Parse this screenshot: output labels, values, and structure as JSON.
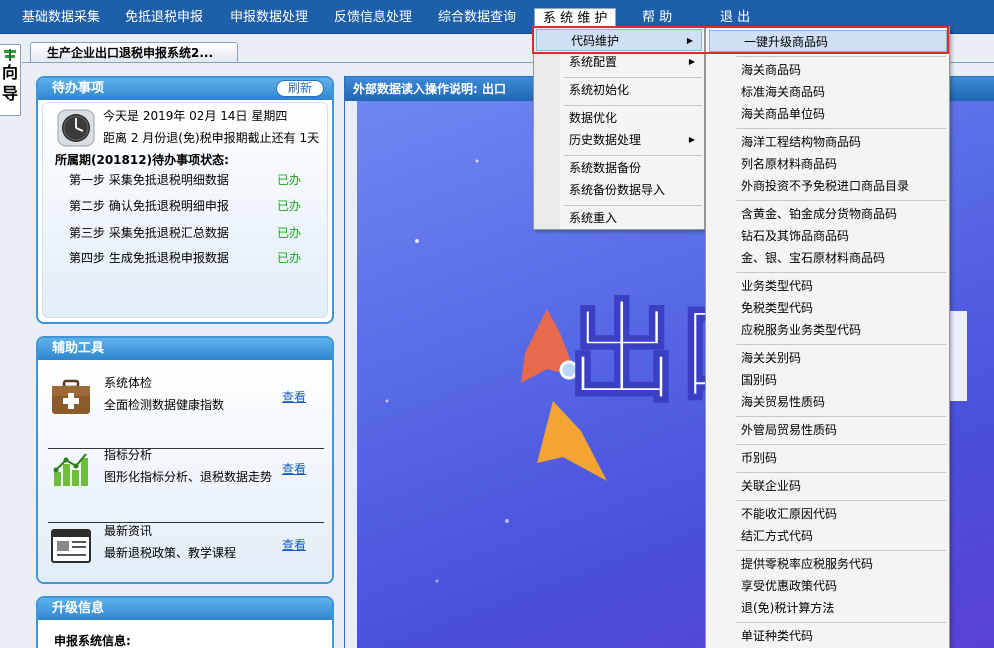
{
  "menubar": {
    "items": [
      "基础数据采集",
      "免抵退税申报",
      "申报数据处理",
      "反馈信息处理",
      "综合数据查询",
      "系 统 维 护",
      "帮   助",
      "退   出"
    ]
  },
  "wizard": {
    "label": "向导"
  },
  "doc_tab": {
    "title": "生产企业出口退税申报系统2..."
  },
  "todo": {
    "title": "待办事项",
    "refresh": "刷新",
    "today": "今天是  2019年  02月  14日  星期四",
    "deadline": "距离 2 月份退(免)税申报期截止还有 1天",
    "state_title": "所属期(201812)待办事项状态:",
    "steps": [
      {
        "label": "第一步  采集免抵退税明细数据",
        "status": "已办"
      },
      {
        "label": "第二步  确认免抵退税明细申报",
        "status": "已办"
      },
      {
        "label": "第三步  采集免抵退税汇总数据",
        "status": "已办"
      },
      {
        "label": "第四步  生成免抵退税申报数据",
        "status": "已办"
      }
    ]
  },
  "tools": {
    "title": "辅助工具",
    "items": [
      {
        "name": "系统体检",
        "desc": "全面检测数据健康指数",
        "link": "查看"
      },
      {
        "name": "指标分析",
        "desc": "图形化指标分析、退税数据走势",
        "link": "查看"
      },
      {
        "name": "最新资讯",
        "desc": "最新退税政策、教学课程",
        "link": "查看"
      }
    ]
  },
  "upgrade": {
    "title": "升级信息",
    "sub": "申报系统信息:"
  },
  "main": {
    "header": "外部数据读入操作说明:  出口",
    "banner_text": "出口"
  },
  "menu1": {
    "items": [
      "代码维护",
      "系统配置",
      "系统初始化",
      "数据优化",
      "历史数据处理",
      "系统数据备份",
      "系统备份数据导入",
      "系统重入"
    ]
  },
  "menu2": {
    "items": [
      "一键升级商品码",
      "海关商品码",
      "标准海关商品码",
      "海关商品单位码",
      "海洋工程结构物商品码",
      "列名原材料商品码",
      "外商投资不予免税进口商品目录",
      "含黄金、铂金成分货物商品码",
      "钻石及其饰品商品码",
      "金、银、宝石原材料商品码",
      "业务类型代码",
      "免税类型代码",
      "应税服务业务类型代码",
      "海关关别码",
      "国别码",
      "海关贸易性质码",
      "外管局贸易性质码",
      "币别码",
      "关联企业码",
      "不能收汇原因代码",
      "结汇方式代码",
      "提供零税率应税服务代码",
      "享受优惠政策代码",
      "退(免)税计算方法",
      "单证种类代码"
    ]
  },
  "colors": {
    "accent": "#1d5fa8",
    "highlight": "#cfe0f4",
    "red_box": "#e12a2a",
    "done": "#1aa51a"
  }
}
